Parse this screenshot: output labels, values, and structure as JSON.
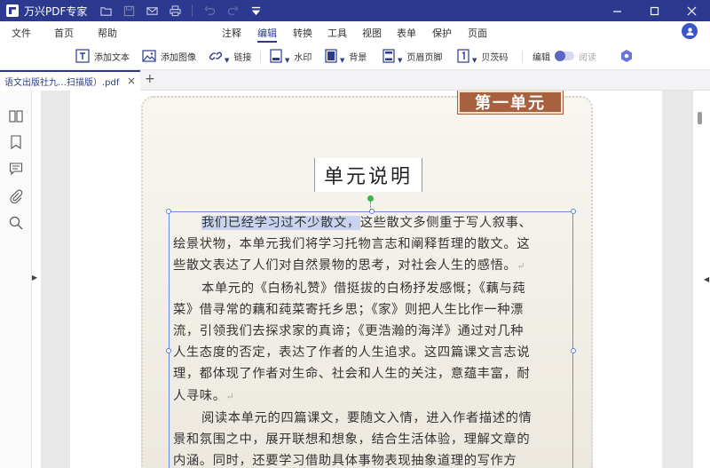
{
  "app": {
    "title": "万兴PDF专家"
  },
  "quick_access": [
    "folder-icon",
    "save-icon",
    "mail-icon",
    "print-icon",
    "undo-icon",
    "redo-icon",
    "customize-icon"
  ],
  "menu": {
    "file": "文件",
    "home": "首页",
    "help": "帮助",
    "tabs": [
      "注释",
      "编辑",
      "转换",
      "工具",
      "视图",
      "表单",
      "保护",
      "页面"
    ],
    "active_tab": "编辑"
  },
  "toolbar": {
    "add_text": "添加文本",
    "add_image": "添加图像",
    "link": "链接",
    "watermark": "水印",
    "background": "背景",
    "header_footer": "页眉页脚",
    "bates": "贝茨码",
    "edit": "编辑",
    "read": "阅读"
  },
  "tabs": {
    "doc_tab_label": "语文出版社九…扫描版）.pdf",
    "close": "×",
    "add": "+"
  },
  "sidebar": {
    "icons": [
      "thumbnails-icon",
      "bookmark-icon",
      "comment-icon",
      "attachment-icon",
      "search-icon"
    ]
  },
  "page": {
    "unit_banner": "第一单元",
    "unit_title": "单元说明",
    "highlighted": "我们已经学习过不少散文，",
    "lines": [
      "这些散文多侧重于写人叙事、",
      "绘景状物，本单元我们将学习托物言志和阐释哲理的散文。这",
      "些散文表达了人们对自然景物的思考，对社会人生的感悟。",
      "本单元的《白杨礼赞》借挺拔的白杨抒发感慨；《藕与莼",
      "菜》借寻常的藕和莼菜寄托乡思；《家》则把人生比作一种漂",
      "流，引领我们去探求家的真谛；《更浩瀚的海洋》通过对几种",
      "人生态度的否定，表达了作者的人生追求。这四篇课文言志说",
      "理，都体现了作者对生命、社会和人生的关注，意蕴丰富，耐",
      "人寻味。",
      "阅读本单元的四篇课文，要随文入情，进入作者描述的情",
      "景和氛围之中，展开联想和想象，结合生活体验，理解文章的",
      "内涵。同时，还要学习借助具体事物表现抽象道理的写作方"
    ],
    "para_mark": "↵"
  }
}
